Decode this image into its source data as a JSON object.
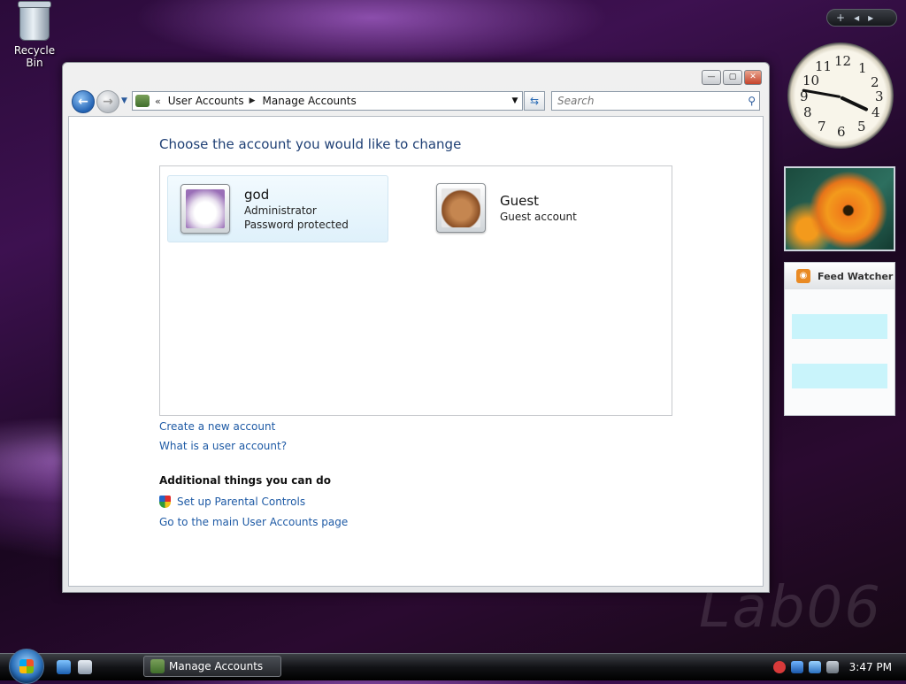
{
  "desktop": {
    "recycle_bin_label": "Recycle Bin",
    "watermark": "Lab06"
  },
  "window": {
    "controls": {
      "minimize": "—",
      "maximize": "▢",
      "close": "✕"
    },
    "address": {
      "breadcrumbs": [
        "User Accounts",
        "Manage Accounts"
      ]
    },
    "search": {
      "placeholder": "Search"
    }
  },
  "content": {
    "title": "Choose the account you would like to change",
    "accounts": [
      {
        "name": "god",
        "lines": [
          "Administrator",
          "Password protected"
        ],
        "selected": true,
        "picture": "cat-picture"
      },
      {
        "name": "Guest",
        "lines": [
          "Guest account"
        ],
        "selected": false,
        "picture": "briefcase-picture"
      }
    ],
    "links": {
      "create_account": "Create a new account",
      "what_is_account": "What is a user account?"
    },
    "additional": {
      "heading": "Additional things you can do",
      "parental_controls": "Set up Parental Controls",
      "main_page": "Go to the main User Accounts page"
    }
  },
  "sidebar_gadgets": {
    "clock_numbers": [
      "12",
      "1",
      "2",
      "3",
      "4",
      "5",
      "6",
      "7",
      "8",
      "9",
      "10",
      "11"
    ],
    "clock_time_display": "3:47",
    "feed_watcher_title": "Feed Watcher"
  },
  "taskbar": {
    "task_button_label": "Manage Accounts",
    "clock": "3:47 PM"
  },
  "colors": {
    "link": "#1e5aa5",
    "title": "#1e3f74",
    "selected_bg": "#dff1fb"
  }
}
